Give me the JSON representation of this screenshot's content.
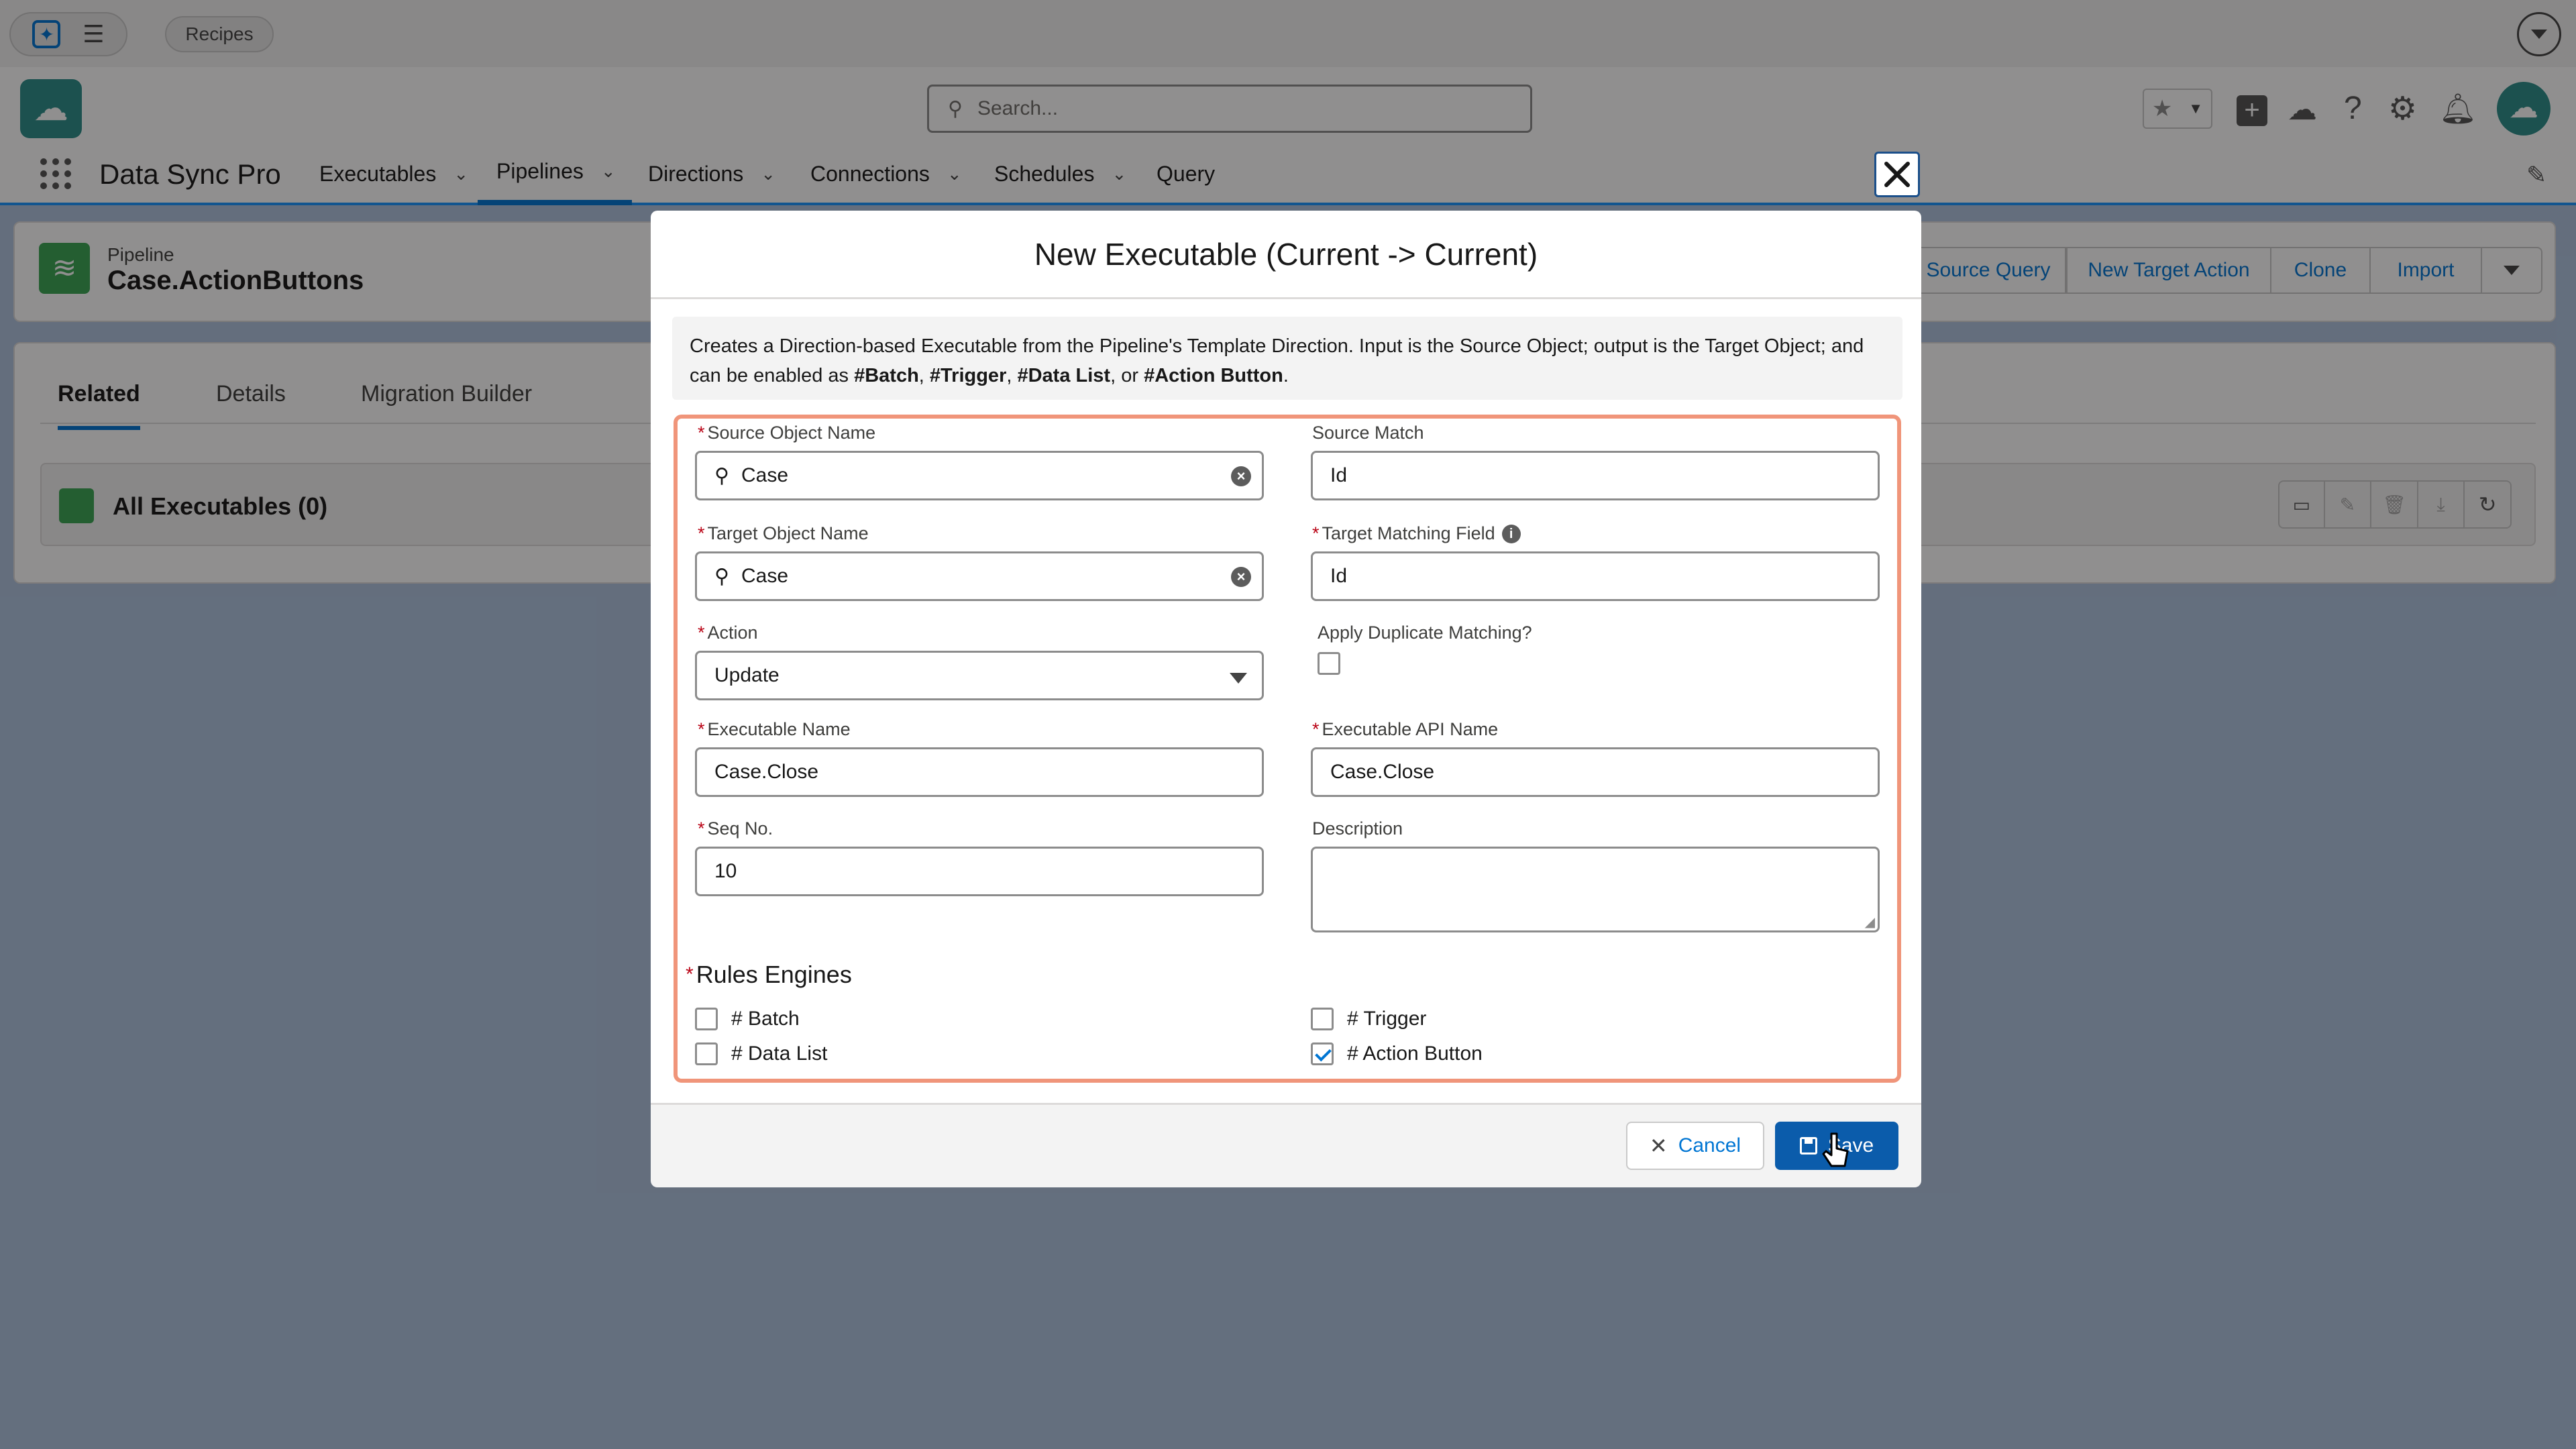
{
  "topbar": {
    "recipes_label": "Recipes"
  },
  "header": {
    "search_placeholder": "Search..."
  },
  "nav": {
    "app_name": "Data Sync Pro",
    "items": [
      {
        "label": "Executables"
      },
      {
        "label": "Pipelines"
      },
      {
        "label": "Directions"
      },
      {
        "label": "Connections"
      },
      {
        "label": "Schedules"
      },
      {
        "label": "Query"
      }
    ]
  },
  "record": {
    "type_label": "Pipeline",
    "name": "Case.ActionButtons",
    "actions": [
      "Source Query",
      "New Target Action",
      "Clone",
      "Import"
    ]
  },
  "tabs": [
    "Related",
    "Details",
    "Migration Builder"
  ],
  "related_list": {
    "title": "All Executables (0)"
  },
  "modal": {
    "title": "New Executable (Current -> Current)",
    "info_text_1": "Creates a Direction-based Executable from the Pipeline's Template Direction. Input is the Source Object; output is the Target Object; and",
    "info_text_2_prefix": "can be enabled as ",
    "info_batch": "#Batch",
    "info_trigger": "#Trigger",
    "info_datalist": "#Data List",
    "info_or": ", or ",
    "info_actionbutton": "#Action Button",
    "fields": {
      "source_object_label": "Source Object Name",
      "source_object_value": "Case",
      "source_match_label": "Source Match",
      "source_match_value": "Id",
      "target_object_label": "Target Object Name",
      "target_object_value": "Case",
      "target_matching_label": "Target Matching Field",
      "target_matching_value": "Id",
      "action_label": "Action",
      "action_value": "Update",
      "apply_dup_label": "Apply Duplicate Matching?",
      "exec_name_label": "Executable Name",
      "exec_name_value": "Case.Close",
      "exec_api_label": "Executable API Name",
      "exec_api_value": "Case.Close",
      "seq_label": "Seq No.",
      "seq_value": "10",
      "description_label": "Description"
    },
    "rules": {
      "title": "Rules Engines",
      "batch": "# Batch",
      "trigger": "# Trigger",
      "datalist": "# Data List",
      "actionbutton": "# Action Button"
    },
    "cancel_label": "Cancel",
    "save_label": "Save"
  },
  "colors": {
    "brand_blue": "#0176d3",
    "save_blue": "#0b5cab",
    "highlight_border": "#f0957a"
  }
}
